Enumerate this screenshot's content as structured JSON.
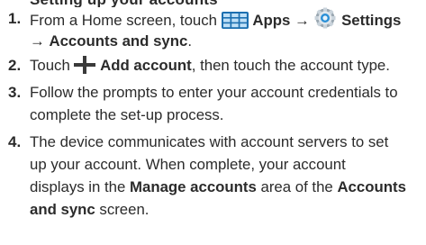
{
  "clipped_header": "Setting up your accounts",
  "steps": [
    {
      "number": "1.",
      "lines": {
        "l1_pre": "From a Home screen, touch",
        "l1_apps": "Apps",
        "l1_arrow": "→",
        "l1_settings": "Settings",
        "l2_arrow": "→",
        "l2_accounts": "Accounts and sync",
        "l2_post": "."
      },
      "icons": [
        "apps-grid-icon",
        "settings-gear-icon"
      ]
    },
    {
      "number": "2.",
      "lines": {
        "pre": "Touch",
        "bold": "Add account",
        "post": ", then touch the account type."
      },
      "icons": [
        "plus-icon"
      ]
    },
    {
      "number": "3.",
      "lines": {
        "l1": "Follow the prompts to enter your account credentials to",
        "l2": "complete the set-up process."
      }
    },
    {
      "number": "4.",
      "lines": {
        "l1": "The device communicates with account servers to set",
        "l2": "up your account. When complete, your account",
        "l3_pre": "displays in the",
        "l3_bold1": "Manage accounts",
        "l3_mid": "area of the",
        "l3_bold2": "Accounts",
        "l4_bold": "and sync",
        "l4_post": "screen."
      }
    }
  ]
}
